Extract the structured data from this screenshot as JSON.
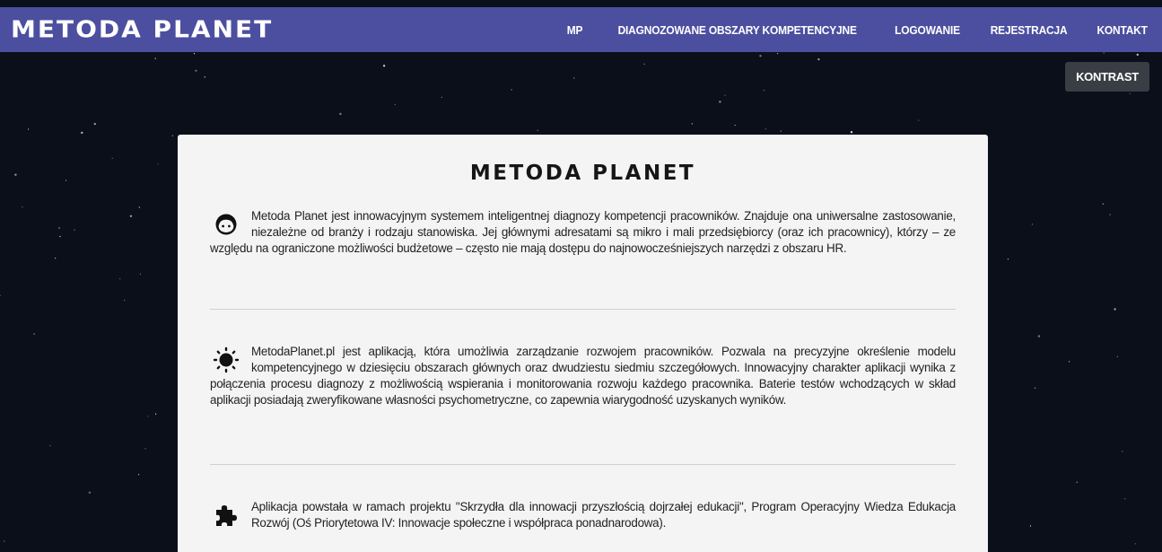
{
  "header": {
    "logo": "METODA PLANET",
    "nav": [
      {
        "label": "MP"
      },
      {
        "label": "DIAGNOZOWANE OBSZARY KOMPETENCYJNE"
      },
      {
        "label": "LOGOWANIE"
      },
      {
        "label": "REJESTRACJA"
      },
      {
        "label": "KONTAKT"
      }
    ]
  },
  "contrast_button": "KONTRAST",
  "card": {
    "title": "METODA PLANET",
    "sections": [
      {
        "icon": "face-icon",
        "text": "Metoda Planet jest innowacyjnym systemem inteligentnej diagnozy kompetencji pracowników. Znajduje ona uniwersalne zastosowanie, niezależne od branży i rodzaju stanowiska. Jej głównymi adresatami są mikro i mali przedsiębiorcy (oraz ich pracownicy), którzy – ze względu na ograniczone możliwości budżetowe – często nie mają dostępu do najnowocześniejszych narzędzi z obszaru HR."
      },
      {
        "icon": "sun-icon",
        "text": "MetodaPlanet.pl jest aplikacją, która umożliwia zarządzanie rozwojem pracowników. Pozwala na precyzyjne określenie modelu kompetencyjnego w dziesięciu obszarach głównych oraz dwudziestu siedmiu szczegółowych. Innowacyjny charakter aplikacji wynika z połączenia procesu diagnozy z możliwością wspierania i monitorowania rozwoju każdego pracownika. Baterie testów wchodzących w skład aplikacji posiadają zweryfikowane własności psychometryczne, co zapewnia wiarygodność uzyskanych wyników."
      },
      {
        "icon": "puzzle-icon",
        "text": "Aplikacja powstała w ramach projektu \"Skrzydła dla innowacji przyszłością dojrzałej edukacji\", Program Operacyjny Wiedza Edukacja Rozwój (Oś Priorytetowa IV: Innowacje społeczne i współpraca ponadnarodowa)."
      }
    ]
  },
  "colors": {
    "header_bg": "#4c4f9f",
    "page_bg": "#0b0f1a",
    "card_bg": "#f4f4f4",
    "button_bg": "#3a3d44"
  }
}
